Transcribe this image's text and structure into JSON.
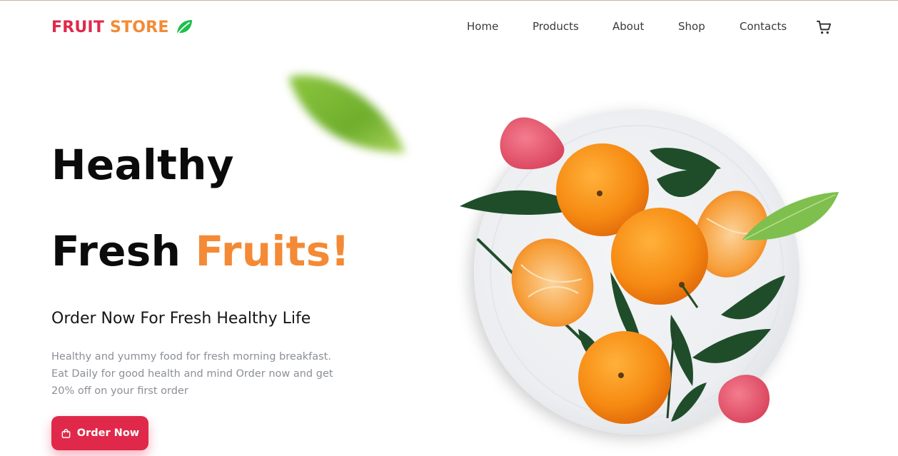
{
  "brand": {
    "word1": "FRUIT",
    "word2": "STORE",
    "icon": "leaf-icon",
    "color1": "#e0294a",
    "color2": "#f48a35",
    "icon_color": "#1fbf4a"
  },
  "nav": {
    "items": [
      {
        "label": "Home"
      },
      {
        "label": "Products"
      },
      {
        "label": "About"
      },
      {
        "label": "Shop"
      },
      {
        "label": "Contacts"
      }
    ],
    "cart_icon": "cart-icon"
  },
  "hero": {
    "line1": "Healthy",
    "line2_word1": "Fresh",
    "line2_word2": "Fruits!",
    "subtitle": "Order Now For Fresh Healthy Life",
    "description": "Healthy and yummy food for fresh morning breakfast. Eat Daily for good health and mind Order now and get 20% off on your first order",
    "cta_label": "Order Now",
    "cta_icon": "shopping-bag-icon",
    "accent": "#f48a35",
    "cta_color": "#e0294a"
  },
  "art": {
    "plate_icon": "plate-of-oranges-image",
    "leaf_icon": "floating-leaf-image",
    "raspberry_icon": "raspberry-image"
  }
}
